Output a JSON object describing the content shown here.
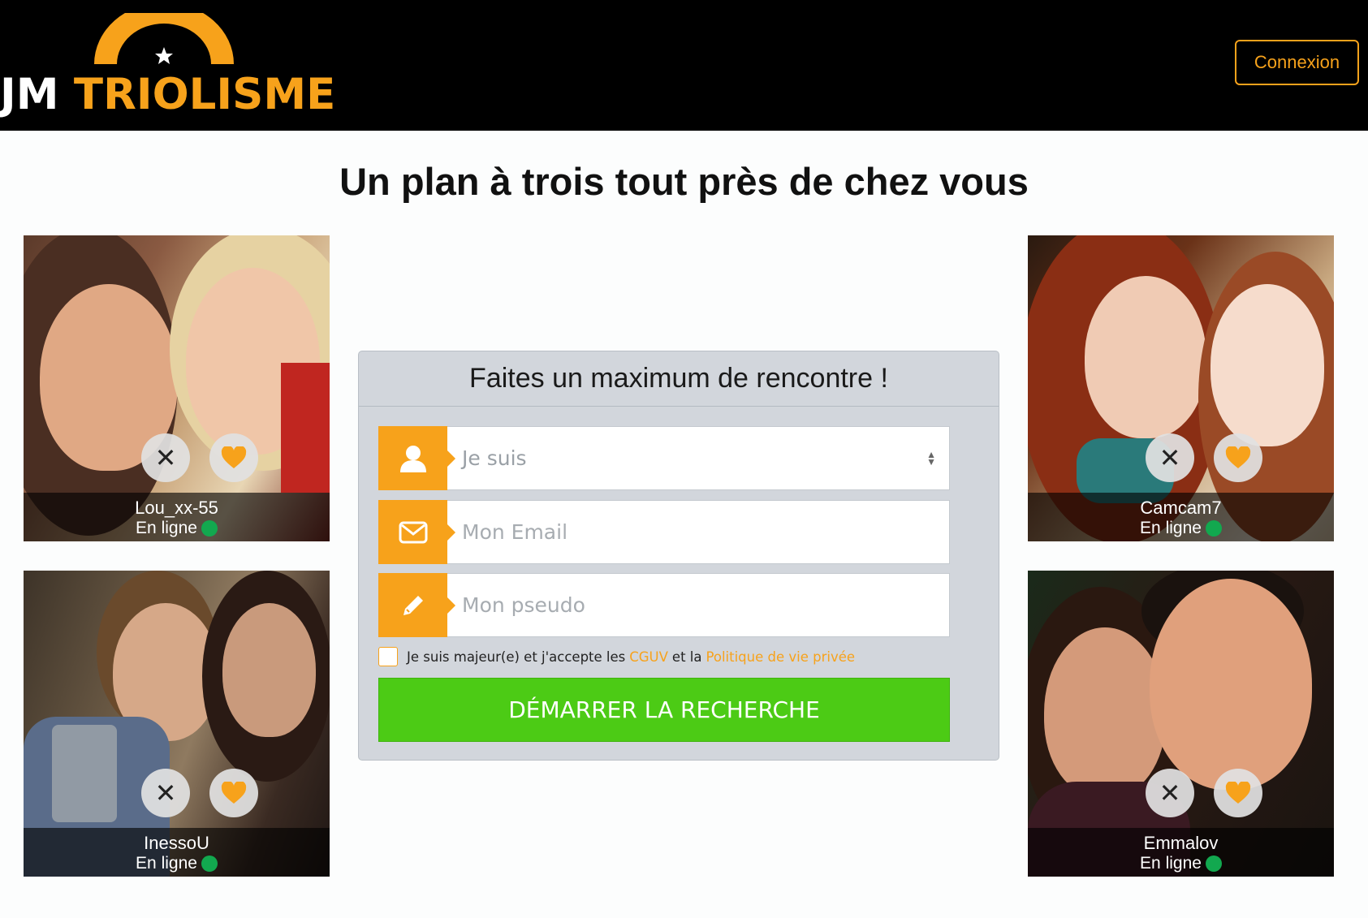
{
  "header": {
    "logo_part1": "JM",
    "logo_part2": "TRIOLISME",
    "login_label": "Connexion"
  },
  "headline": "Un plan à trois tout près de chez vous",
  "profiles": [
    {
      "name": "Lou_xx-55",
      "status": "En ligne"
    },
    {
      "name": "InessoU",
      "status": "En ligne"
    },
    {
      "name": "Camcam7",
      "status": "En ligne"
    },
    {
      "name": "Emmalov",
      "status": "En ligne"
    }
  ],
  "form": {
    "title": "Faites un maximum de rencontre !",
    "gender_placeholder": "Je suis",
    "email_placeholder": "Mon Email",
    "pseudo_placeholder": "Mon pseudo",
    "terms_prefix": "Je suis majeur(e) et j'accepte les",
    "terms_link1": "CGUV",
    "terms_mid": "et la",
    "terms_link2": "Politique de vie privée",
    "submit_label": "DÉMARRER LA RECHERCHE"
  },
  "colors": {
    "accent": "#f7a21b",
    "header_bg": "#000000",
    "cta_green": "#4ccb15",
    "online_green": "#12a84f"
  }
}
